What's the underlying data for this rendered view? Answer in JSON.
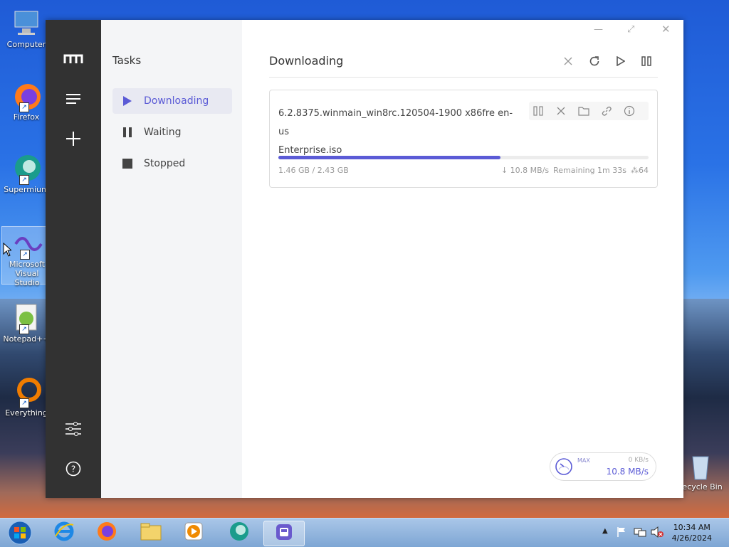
{
  "desktop": {
    "icons": [
      {
        "label": "Computer"
      },
      {
        "label": "Firefox"
      },
      {
        "label": "Supermium"
      },
      {
        "label": "Microsoft Visual Studio"
      },
      {
        "label": "Notepad++"
      },
      {
        "label": "Everything"
      },
      {
        "label": "Recycle Bin"
      }
    ]
  },
  "sidebar": {
    "title": "Tasks",
    "items": [
      {
        "label": "Downloading",
        "icon": "play-icon",
        "active": true
      },
      {
        "label": "Waiting",
        "icon": "pause-icon"
      },
      {
        "label": "Stopped",
        "icon": "stop-icon"
      }
    ]
  },
  "main": {
    "title": "Downloading"
  },
  "task": {
    "filename_line1": "6.2.8375.winmain_win8rc.120504-1900 x86fre en-us",
    "filename_line2": "Enterprise.iso",
    "size_progress": "1.46 GB / 2.43 GB",
    "progress_fraction": 0.6,
    "speed": "↓ 10.8 MB/s",
    "remaining": "Remaining 1m 33s",
    "connections": "64"
  },
  "speedometer": {
    "max_label": "MAX",
    "upload": "0 KB/s",
    "download": "10.8 MB/s"
  },
  "taskbar": {
    "time": "10:34 AM",
    "date": "4/26/2024"
  },
  "colors": {
    "accent": "#5b5bd6",
    "rail": "#323232"
  }
}
